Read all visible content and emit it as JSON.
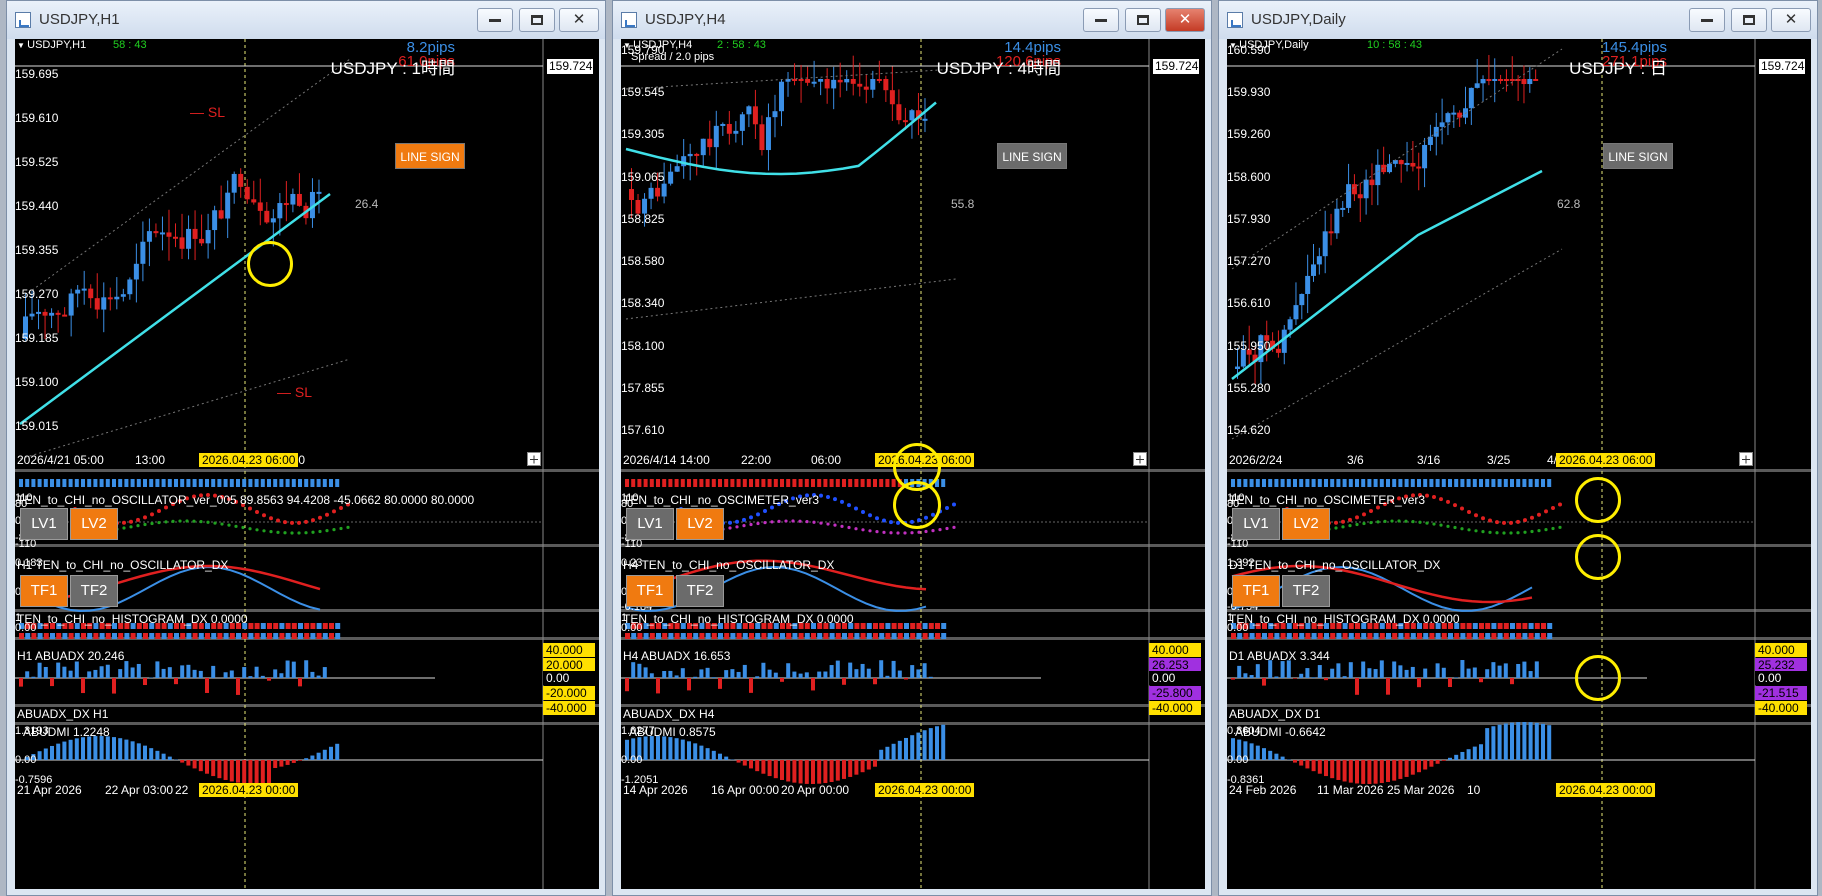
{
  "windows": [
    {
      "title": "USDJPY,H1",
      "symbol_label": "USDJPY,H1",
      "timer": "58 : 43",
      "pips_a": "8.2pips",
      "pips_b": "61.0pips",
      "tf_name": "USDJPY : 1時間",
      "line_sign": "LINE SIGN",
      "adx_value": "26.4",
      "sl_labels": [
        "SL",
        "SL"
      ],
      "current_price": "159.724",
      "price_scale": [
        "159.695",
        "159.610",
        "159.525",
        "159.440",
        "159.355",
        "159.270",
        "159.185",
        "159.100",
        "159.015"
      ],
      "time_labels": [
        "2026/4/21 05:00",
        "13:00",
        "21:",
        "13:00"
      ],
      "time_highlight": "2026.04.23 06:00",
      "osc_title": "TEN_to_CHI_no_OSCILLATOR_ver_005 89.8563 94.4208 -45.0662 80.0000 80.0000",
      "osc_levels": [
        "110",
        "80",
        "0.00",
        "-80",
        "-110"
      ],
      "dx_title": "H1 TEN_to_CHI_no_OSCILLATOR_DX",
      "dx_levels": [
        "0.183",
        "0.011"
      ],
      "hist_title": "TEN_to_CHI_no_HISTOGRAM_DX 0.0000",
      "hist_levels": [
        "1",
        "0.00"
      ],
      "abuadx_title": "H1 ABUADX 20.246",
      "abuadx_levels": [
        "40.000",
        "20.000",
        "0.00",
        "-20.000",
        "-40.000"
      ],
      "abuadx_sub": "ABUADX_DX H1",
      "abudmi_title": "ABUDMI 1.2248",
      "abudmi_levels": [
        "1.3193",
        "0.00",
        "-0.7596"
      ],
      "bottom_time": [
        "21 Apr 2026",
        "22 Apr 03:00",
        "22",
        "r 03:00"
      ],
      "bottom_highlight": "2026.04.23 00:00",
      "lv_buttons": [
        "LV1",
        "LV2"
      ],
      "tf_buttons": [
        "TF1",
        "TF2"
      ]
    },
    {
      "title": "USDJPY,H4",
      "symbol_label": "USDJPY,H4",
      "timer": "2 : 58 : 43",
      "spread": "Spread / 2.0 pips",
      "pips_a": "14.4pips",
      "pips_b": "120.6pips",
      "tf_name": "USDJPY : 4時間",
      "line_sign": "LINE SIGN",
      "adx_value": "55.8",
      "current_price": "159.724",
      "price_scale": [
        "159.790",
        "159.545",
        "159.305",
        "159.065",
        "158.825",
        "158.580",
        "158.340",
        "158.100",
        "157.855",
        "157.610"
      ],
      "time_labels": [
        "2026/4/14 14:00",
        "22:00",
        "06:00",
        "14:00"
      ],
      "time_highlight": "2026.04.23 06:00",
      "osc_title": "TEN_to_CHI_no_OSCIMETER_ver3",
      "osc_levels": [
        "110",
        "80",
        "0.00",
        "-80",
        "-110"
      ],
      "dx_title": "H4 TEN_to_CHI_no_OSCILLATOR_DX",
      "dx_levels": [
        "0.23",
        "0.00",
        "-0.184"
      ],
      "hist_title": "TEN_to_CHI_no_HISTOGRAM_DX 0.0000",
      "hist_levels": [
        "1",
        "0.00"
      ],
      "abuadx_title": "H4 ABUADX 16.653",
      "abuadx_levels": [
        "40.000",
        "26.253",
        "0.00",
        "-25.800",
        "-40.000"
      ],
      "abuadx_sub": "ABUADX_DX H4",
      "abudmi_title": "ABUDMI 0.8575",
      "abudmi_levels": [
        "1.0277",
        "0.00",
        "-1.2051"
      ],
      "bottom_time": [
        "14 Apr 2026",
        "16 Apr 00:00",
        "20 Apr 00:00"
      ],
      "bottom_highlight": "2026.04.23 00:00",
      "lv_buttons": [
        "LV1",
        "LV2"
      ],
      "tf_buttons": [
        "TF1",
        "TF2"
      ]
    },
    {
      "title": "USDJPY,Daily",
      "symbol_label": "USDJPY,Daily",
      "timer": "10 : 58 : 43",
      "pips_a": "145.4pips",
      "pips_b": "271.1pips",
      "tf_name": "USDJPY : 日",
      "line_sign": "LINE SIGN",
      "adx_value": "62.8",
      "current_price": "159.724",
      "price_scale": [
        "160.590",
        "159.930",
        "159.260",
        "158.600",
        "157.930",
        "157.270",
        "156.610",
        "155.950",
        "155.280",
        "154.620"
      ],
      "time_labels": [
        "2026/2/24",
        "3/6",
        "3/16",
        "3/25",
        "4/6"
      ],
      "time_highlight": "2026.04.23 06:00",
      "osc_title": "TEN_to_CHI_no_OSCIMETER_ver3",
      "osc_levels": [
        "110",
        "80",
        "0.00",
        "-80",
        "-110"
      ],
      "dx_title": "D1 TEN_to_CHI_no_OSCILLATOR_DX",
      "dx_levels": [
        "1.392",
        "0.00",
        "-0.754"
      ],
      "hist_title": "TEN_to_CHI_no_HISTOGRAM_DX 0.0000",
      "hist_levels": [
        "1",
        "0.00"
      ],
      "abuadx_title": "D1 ABUADX 3.344",
      "abuadx_levels": [
        "40.000",
        "25.232",
        "0.00",
        "-21.515",
        "-40.000"
      ],
      "abuadx_sub": "ABUADX_DX D1",
      "abudmi_title": "ABUDMI -0.6642",
      "abudmi_levels": [
        "0.8604",
        "0.00",
        "-0.8361"
      ],
      "bottom_time": [
        "24 Feb 2026",
        "11 Mar 2026",
        "25 Mar 2026",
        "10"
      ],
      "bottom_highlight": "2026.04.23 00:00",
      "lv_buttons": [
        "LV1",
        "LV2"
      ],
      "tf_buttons": [
        "TF1",
        "TF2"
      ]
    }
  ],
  "colors": {
    "bull": "#3b8fe6",
    "bear": "#e02020",
    "ma": "#40e0e8",
    "highlight": "#ffe000",
    "accent": "#f07a10"
  },
  "icons": {
    "window": "chart-window-icon",
    "minimize": "minimize-icon",
    "maximize": "maximize-icon",
    "close": "close-icon"
  }
}
